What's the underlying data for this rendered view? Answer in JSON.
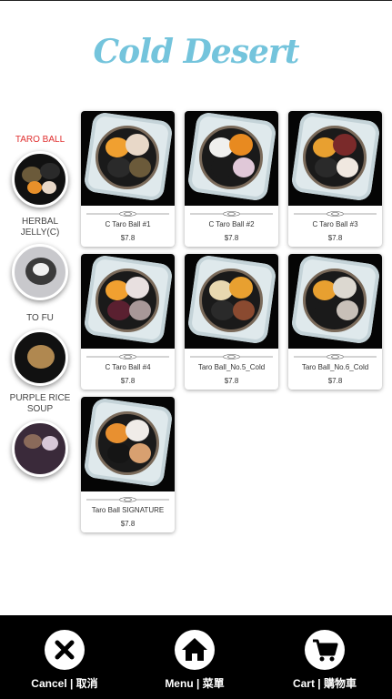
{
  "app": {
    "title": "Cold Desert"
  },
  "sidebar": {
    "items": [
      {
        "label": "TARO BALL",
        "active": true
      },
      {
        "label": "HERBAL JELLY(C)",
        "active": false
      },
      {
        "label": "TO FU",
        "active": false
      },
      {
        "label": "PURPLE RICE SOUP",
        "active": false
      }
    ]
  },
  "products": [
    {
      "name": "C Taro Ball #1",
      "price": "$7.8"
    },
    {
      "name": "C Taro Ball #2",
      "price": "$7.8"
    },
    {
      "name": "C Taro Ball #3",
      "price": "$7.8"
    },
    {
      "name": "C Taro Ball #4",
      "price": "$7.8"
    },
    {
      "name": "Taro Ball_No.5_Cold",
      "price": "$7.8"
    },
    {
      "name": "Taro Ball_No.6_Cold",
      "price": "$7.8"
    },
    {
      "name": "Taro Ball SIGNATURE",
      "price": "$7.8"
    }
  ],
  "bottom_nav": {
    "cancel": {
      "label": "Cancel | 取消",
      "icon": "close-icon"
    },
    "menu": {
      "label": "Menu | 菜單",
      "icon": "home-icon"
    },
    "cart": {
      "label": "Cart | 購物車",
      "icon": "cart-icon"
    }
  },
  "colors": {
    "title": "#74c4dc",
    "active_category": "#e03030",
    "bottom_bar": "#000000"
  }
}
